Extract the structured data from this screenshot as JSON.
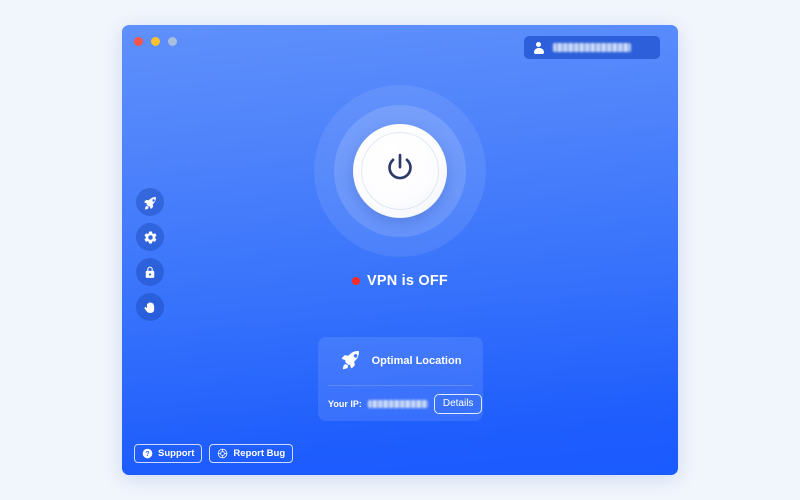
{
  "window": {
    "traffic_lights": [
      {
        "name": "close",
        "color": "#f9544b"
      },
      {
        "name": "minimize",
        "color": "#f9c22e"
      },
      {
        "name": "maximize",
        "color": "#a8bedd"
      }
    ],
    "gradient_from": "#5f90fb",
    "gradient_to": "#1a5bff"
  },
  "account": {
    "icon": "person-icon",
    "username_redacted": "",
    "redacted": true
  },
  "sidebar": {
    "items": [
      {
        "icon": "rocket-icon",
        "name": "boost"
      },
      {
        "icon": "gear-icon",
        "name": "settings"
      },
      {
        "icon": "lock-icon",
        "name": "security"
      },
      {
        "icon": "hand-icon",
        "name": "block"
      }
    ]
  },
  "power": {
    "icon": "power-icon",
    "state": "off"
  },
  "status": {
    "label": "VPN is OFF",
    "dot_color": "#ff2b21"
  },
  "location_card": {
    "icon": "rocket-icon",
    "label": "Optimal Location",
    "ip_label": "Your IP:",
    "ip_value_redacted": "",
    "details_label": "Details"
  },
  "bottom_bar": {
    "buttons": [
      {
        "label": "Support",
        "icon": "question-circle-icon"
      },
      {
        "label": "Report Bug",
        "icon": "bug-target-icon"
      }
    ]
  }
}
